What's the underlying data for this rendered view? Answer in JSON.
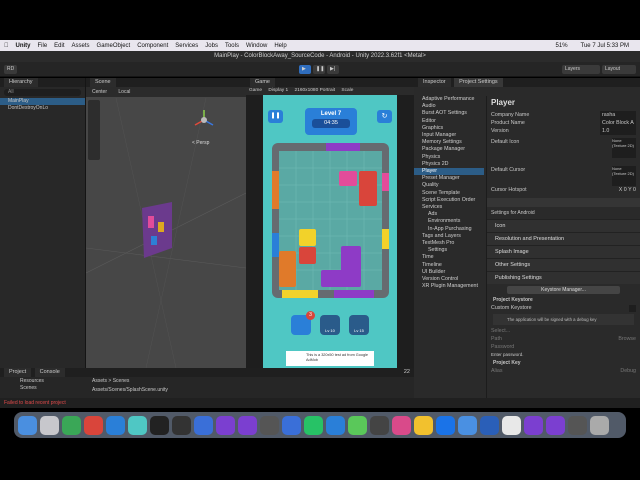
{
  "menubar": {
    "app": "Unity",
    "items": [
      "File",
      "Edit",
      "Assets",
      "GameObject",
      "Component",
      "Services",
      "Jobs",
      "Tools",
      "Window",
      "Help"
    ],
    "battery": "51%",
    "clock": "Tue 7 Jul  5:33 PM"
  },
  "window": {
    "title": "MainPlay - ColorBlockAway_SourceCode - Android - Unity 2022.3.62f1 <Metal>"
  },
  "toolbar": {
    "account": "RD",
    "layers": "Layers",
    "layout": "Layout"
  },
  "hierarchy": {
    "tab": "Hierarchy",
    "search_placeholder": "All",
    "items": [
      "MainPlay",
      "DontDestroyOnLo"
    ]
  },
  "scene": {
    "tab": "Scene",
    "pivot": "Center",
    "space": "Local",
    "view": "< Persp"
  },
  "game": {
    "tab": "Game",
    "mode": "Game",
    "display": "Display 1",
    "resolution": "2160x1080 Portrait",
    "scale_label": "Scale",
    "level": "Level 7",
    "timer": "04:35",
    "boosters": [
      {
        "badge": "3",
        "label": ""
      },
      {
        "badge": "",
        "label": "Lv 10"
      },
      {
        "badge": "",
        "label": "Lv 15"
      }
    ],
    "ad_text": "This is a 320x50 test ad from Google AdMob"
  },
  "project": {
    "tab1": "Project",
    "tab2": "Console",
    "folders": [
      "Resources",
      "Scenes"
    ],
    "path": "Assets > Scenes",
    "file": "Assets/Scenes/SplashScene.unity",
    "count": "22"
  },
  "status": {
    "error": "Failed to load recent project"
  },
  "inspector": {
    "tab1": "Inspector",
    "tab2": "Project Settings",
    "settings": [
      "Adaptive Performance",
      "Audio",
      "Burst AOT Settings",
      "Editor",
      "Graphics",
      "Input Manager",
      "Memory Settings",
      "Package Manager",
      "Physics",
      "Physics 2D",
      "Player",
      "Preset Manager",
      "Quality",
      "Scene Template",
      "Script Execution Order",
      "Services",
      "Ads",
      "Environments",
      "In-App Purchasing",
      "Tags and Layers",
      "TextMesh Pro",
      "Settings",
      "Time",
      "Timeline",
      "UI Builder",
      "Version Control",
      "XR Plugin Management"
    ],
    "selected": "Player",
    "player_title": "Player",
    "company_label": "Company Name",
    "company_value": "rasha",
    "product_label": "Product Name",
    "product_value": "Color Block A",
    "version_label": "Version",
    "version_value": "1.0",
    "default_icon": "Default Icon",
    "none_texture": "None (Texture 2D)",
    "default_cursor": "Default Cursor",
    "cursor_hotspot": "Cursor Hotspot",
    "hotspot_x": "X 0",
    "hotspot_y": "Y 0",
    "settings_for": "Settings for Android",
    "sections": [
      "Icon",
      "Resolution and Presentation",
      "Splash Image",
      "Other Settings",
      "Publishing Settings"
    ],
    "keystore_manager": "Keystore Manager...",
    "project_keystore": "Project Keystore",
    "custom_keystore": "Custom Keystore",
    "debug_key_note": "The application will be signed with a debug key",
    "select": "Select...",
    "path": "Path",
    "password": "Password",
    "browse": "Browse",
    "enter_password": "Enter password.",
    "project_key": "Project Key",
    "alias": "Alias",
    "debug": "Debug"
  }
}
